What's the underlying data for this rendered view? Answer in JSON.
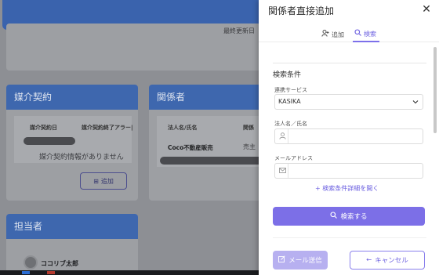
{
  "background": {
    "top_card": {
      "last_update_label": "最終更新日"
    },
    "baikai": {
      "title": "媒介契約",
      "col1": "媒介契約日",
      "col2": "媒介契約終了アラー|",
      "empty_message": "媒介契約情報がありません",
      "add_label": "追加"
    },
    "kankei": {
      "title": "関係者",
      "col1": "法人名/氏名",
      "col2": "関係",
      "row_name": "Coco不動産販売",
      "row_relation": "売主"
    },
    "tanto": {
      "title": "担当者",
      "name": "ココリブ太郎"
    }
  },
  "drawer": {
    "title": "関係者直接追加",
    "close_icon": "close-icon",
    "tabs": [
      {
        "label": "追加",
        "icon": "person-add-icon"
      },
      {
        "label": "検索",
        "icon": "search-icon",
        "active": true
      }
    ],
    "section_title": "検索条件",
    "service_label": "連携サービス",
    "service_value": "KASIKA",
    "name_label": "法人名／氏名",
    "email_label": "メールアドレス",
    "more_link": "+ 検索条件詳細を開く",
    "search_button": "検索する",
    "mail_button": "メール送信",
    "cancel_button": "キャンセル"
  },
  "colors": {
    "accent": "#7c6fe7",
    "header_blue": "#3e67ae"
  }
}
